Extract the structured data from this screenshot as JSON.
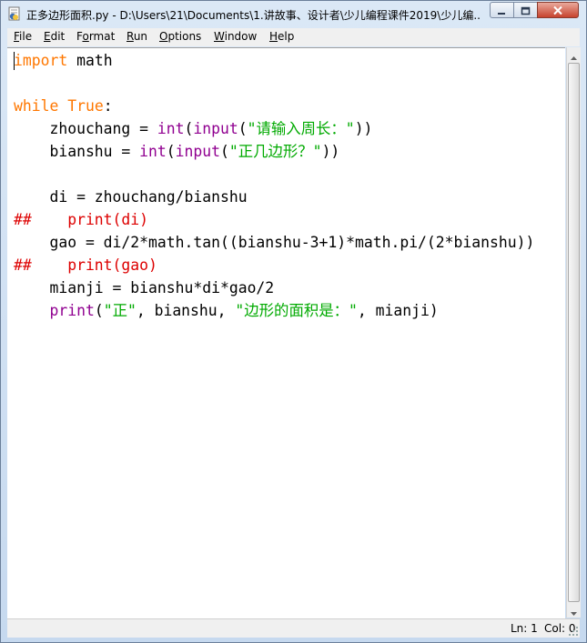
{
  "window": {
    "title": "正多边形面积.py - D:\\Users\\21\\Documents\\1.讲故事、设计者\\少儿编程课件2019\\少儿编...",
    "icons": {
      "app": "python-idle-icon",
      "minimize": "minimize-icon",
      "maximize": "maximize-icon",
      "close": "close-icon"
    }
  },
  "menu": {
    "file": {
      "u": "F",
      "rest": "ile"
    },
    "edit": {
      "u": "E",
      "rest": "dit"
    },
    "format": {
      "pre": "F",
      "u": "o",
      "rest": "rmat"
    },
    "run": {
      "u": "R",
      "rest": "un"
    },
    "options": {
      "u": "O",
      "rest": "ptions"
    },
    "window": {
      "u": "W",
      "rest": "indow"
    },
    "help": {
      "u": "H",
      "rest": "elp"
    }
  },
  "code": {
    "l1": {
      "kw": "import",
      "rest": " math"
    },
    "l3": {
      "kw1": "while",
      "sp": " ",
      "kw2": "True",
      "rest": ":"
    },
    "l4": {
      "a": "    zhouchang = ",
      "b1": "int",
      "p1": "(",
      "b2": "input",
      "p2": "(",
      "s": "\"请输入周长：\"",
      "p3": "))"
    },
    "l5": {
      "a": "    bianshu = ",
      "b1": "int",
      "p1": "(",
      "b2": "input",
      "p2": "(",
      "s": "\"正几边形？\"",
      "p3": "))"
    },
    "l7": {
      "a": "    di = zhouchang/bianshu"
    },
    "l8": {
      "cm": "##    print(di)"
    },
    "l9": {
      "a": "    gao = di/2*math.tan((bianshu-3+1)*math.pi/(2*bianshu))"
    },
    "l10": {
      "cm": "##    print(gao)"
    },
    "l11": {
      "a": "    mianji = bianshu*di*gao/2"
    },
    "l12": {
      "pre": "    ",
      "b": "print",
      "p1": "(",
      "s1": "\"正\"",
      "m": ", bianshu, ",
      "s2": "\"边形的面积是：\"",
      "e": ", mianji)"
    }
  },
  "status": {
    "ln": "Ln: 1",
    "col": "Col: 0"
  },
  "colors": {
    "keyword": "#ff7700",
    "builtin": "#900090",
    "string": "#00aa00",
    "comment": "#dd0000"
  }
}
